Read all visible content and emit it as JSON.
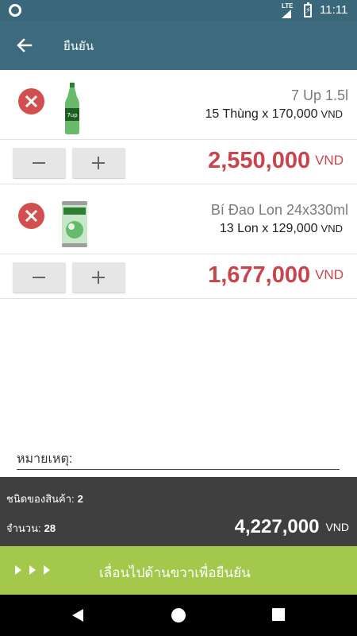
{
  "status_bar": {
    "time": "11:11",
    "network": "LTE"
  },
  "app_bar": {
    "title": "ยืนยัน",
    "back_icon": "arrow-left-icon"
  },
  "items": [
    {
      "name": "7 Up 1.5l",
      "qty_text": "15 Thùng x 170,000",
      "qty_currency": "VND",
      "total": "2,550,000",
      "total_currency": "VND",
      "image": "green-bottle-image"
    },
    {
      "name": "Bí Đao Lon 24x330ml",
      "qty_text": "13 Lon x 129,000",
      "qty_currency": "VND",
      "total": "1,677,000",
      "total_currency": "VND",
      "image": "green-can-image"
    }
  ],
  "note": {
    "placeholder": "หมายเหตุ:"
  },
  "summary": {
    "kinds_label": "ชนิดของสินค้า:",
    "kinds_value": "2",
    "qty_label": "จำนวน:",
    "qty_value": "28",
    "total": "4,227,000",
    "total_currency": "VND"
  },
  "swipe": {
    "label": "เลื่อนไปด้านขวาเพื่อยืนยัน"
  },
  "colors": {
    "app_bar": "#3d6b7d",
    "accent_red": "#c9454d",
    "swipe_green": "#a3c84c",
    "summary_bg": "#3f3f3f"
  }
}
